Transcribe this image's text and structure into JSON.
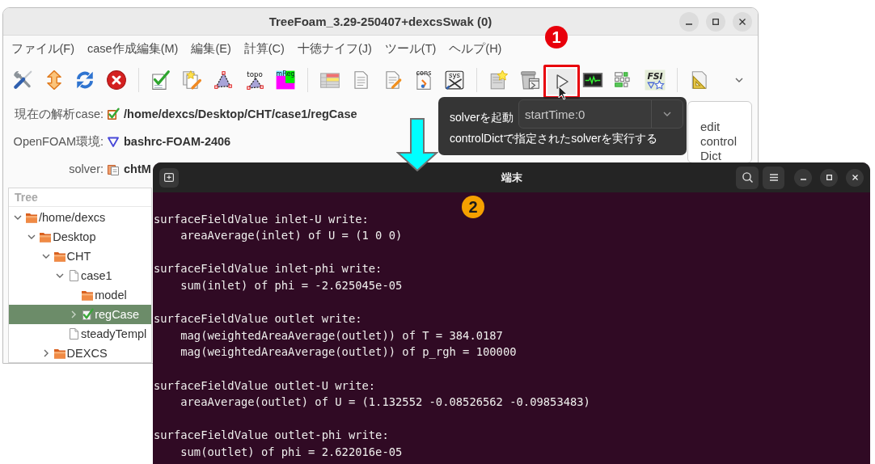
{
  "app_window": {
    "title": "TreeFoam_3.29-250407+dexcsSwak (0)",
    "menu": [
      "ファイル(F)",
      "case作成編集(M)",
      "編集(E)",
      "計算(C)",
      "十徳ナイフ(J)",
      "ツール(T)",
      "ヘルプ(H)"
    ],
    "toolbar": [
      [
        {
          "kind": "tools",
          "highlighted": false
        },
        {
          "kind": "updown",
          "highlighted": false
        },
        {
          "kind": "refresh",
          "highlighted": false
        },
        {
          "kind": "stop",
          "highlighted": false
        }
      ],
      [
        {
          "kind": "checkdoc",
          "highlighted": false
        },
        {
          "kind": "newdoc",
          "highlighted": false
        },
        {
          "kind": "mesh",
          "highlighted": false
        },
        {
          "kind": "topo",
          "text": "topo",
          "highlighted": false
        },
        {
          "kind": "mreg",
          "text": "mReg",
          "highlighted": false
        }
      ],
      [
        {
          "kind": "table",
          "highlighted": false
        },
        {
          "kind": "doc",
          "highlighted": false
        },
        {
          "kind": "editdoc",
          "highlighted": false
        },
        {
          "kind": "cons",
          "text": "cons",
          "highlighted": false
        },
        {
          "kind": "sys",
          "text": "sys",
          "highlighted": false
        }
      ],
      [
        {
          "kind": "stardoc",
          "highlighted": false
        },
        {
          "kind": "bin",
          "highlighted": false
        },
        {
          "kind": "play",
          "highlighted": true
        },
        {
          "kind": "monitor",
          "highlighted": false
        },
        {
          "kind": "blocks",
          "highlighted": false
        },
        {
          "kind": "fsi",
          "text": "FSI",
          "highlighted": false
        }
      ],
      [
        {
          "kind": "ruler",
          "highlighted": false
        }
      ]
    ],
    "case_info": [
      {
        "label": "現在の解析case:",
        "kind": "case",
        "value": "/home/dexcs/Desktop/CHT/case1/regCase"
      },
      {
        "label": "OpenFOAM環境:",
        "kind": "environment",
        "value": "bashrc-FOAM-2406"
      },
      {
        "label": "solver:",
        "kind": "solver",
        "value": "chtM"
      }
    ],
    "start_from": {
      "value": "startTime:0"
    },
    "edit_button": "edit control Dict",
    "tree": {
      "header": "Tree",
      "items": [
        {
          "label": "/home/dexcs",
          "kind": "folder",
          "expanded": true,
          "selected": false,
          "children": [
            {
              "label": "Desktop",
              "kind": "folder",
              "expanded": true,
              "selected": false,
              "children": [
                {
                  "label": "CHT",
                  "kind": "folder",
                  "expanded": true,
                  "selected": false,
                  "children": [
                    {
                      "label": "case1",
                      "kind": "document",
                      "expanded": true,
                      "selected": false,
                      "children": [
                        {
                          "label": "model",
                          "kind": "folder",
                          "selected": false
                        },
                        {
                          "label": "regCase",
                          "kind": "case",
                          "expanded": false,
                          "selected": true
                        }
                      ]
                    },
                    {
                      "label": "steadyTempl",
                      "kind": "document",
                      "selected": false
                    }
                  ]
                },
                {
                  "label": "DEXCS",
                  "kind": "folder",
                  "expanded": false,
                  "selected": false
                }
              ]
            }
          ]
        }
      ]
    }
  },
  "tooltip": {
    "lines": [
      "solverを起動",
      "controlDictで指定されたsolverを実行する"
    ]
  },
  "terminal": {
    "title": "端末",
    "blocks": [
      {
        "heading": "surfaceFieldValue inlet-U write:",
        "lines": [
          "areaAverage(inlet) of U = (1 0 0)"
        ]
      },
      {
        "heading": "surfaceFieldValue inlet-phi write:",
        "lines": [
          "sum(inlet) of phi = -2.625045e-05"
        ]
      },
      {
        "heading": "surfaceFieldValue outlet write:",
        "lines": [
          "mag(weightedAreaAverage(outlet)) of T = 384.0187",
          "mag(weightedAreaAverage(outlet)) of p_rgh = 100000"
        ]
      },
      {
        "heading": "surfaceFieldValue outlet-U write:",
        "lines": [
          "areaAverage(outlet) of U = (1.132552 -0.08526562 -0.09853483)"
        ]
      },
      {
        "heading": "surfaceFieldValue outlet-phi write:",
        "lines": [
          "sum(outlet) of phi = 2.622016e-05"
        ]
      }
    ]
  },
  "annotations": [
    {
      "label": "1",
      "color": "#e8000b"
    },
    {
      "label": "2",
      "color": "#f5a000"
    }
  ]
}
